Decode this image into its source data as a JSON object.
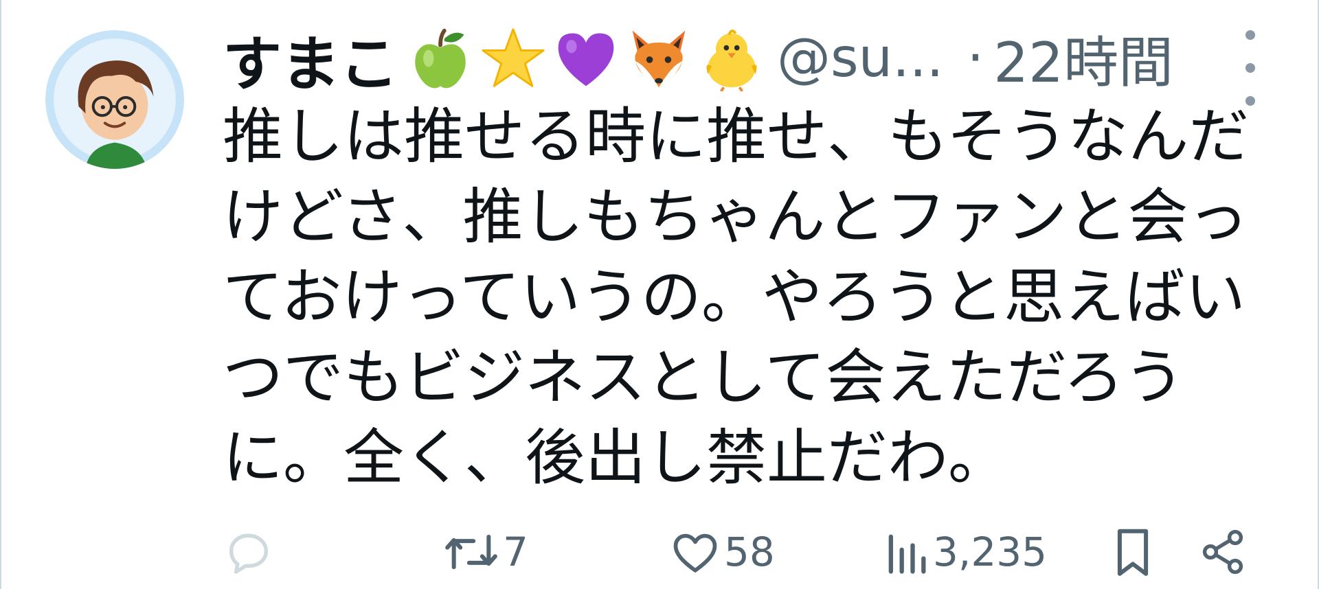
{
  "user": {
    "name": "すまこ",
    "handle": "@su...",
    "separator": "·",
    "time": "22時間",
    "emojis": [
      "green-apple",
      "star",
      "purple-heart",
      "fox",
      "baby-chick"
    ]
  },
  "tweet": {
    "lines": [
      "推しは推せる時に推せ、もそうなんだ",
      "けどさ、推しもちゃんとファンと会っ",
      "ておけっていうの。やろうと思えばい",
      "つでもビジネスとして会えただろう",
      "に。全く、後出し禁止だわ。"
    ]
  },
  "actions": {
    "reply_count": "",
    "retweet_count": "7",
    "like_count": "58",
    "views_count": "3,235"
  },
  "colors": {
    "text": "#0f1419",
    "secondary": "#536471",
    "reply_icon": "#cfd9de"
  }
}
